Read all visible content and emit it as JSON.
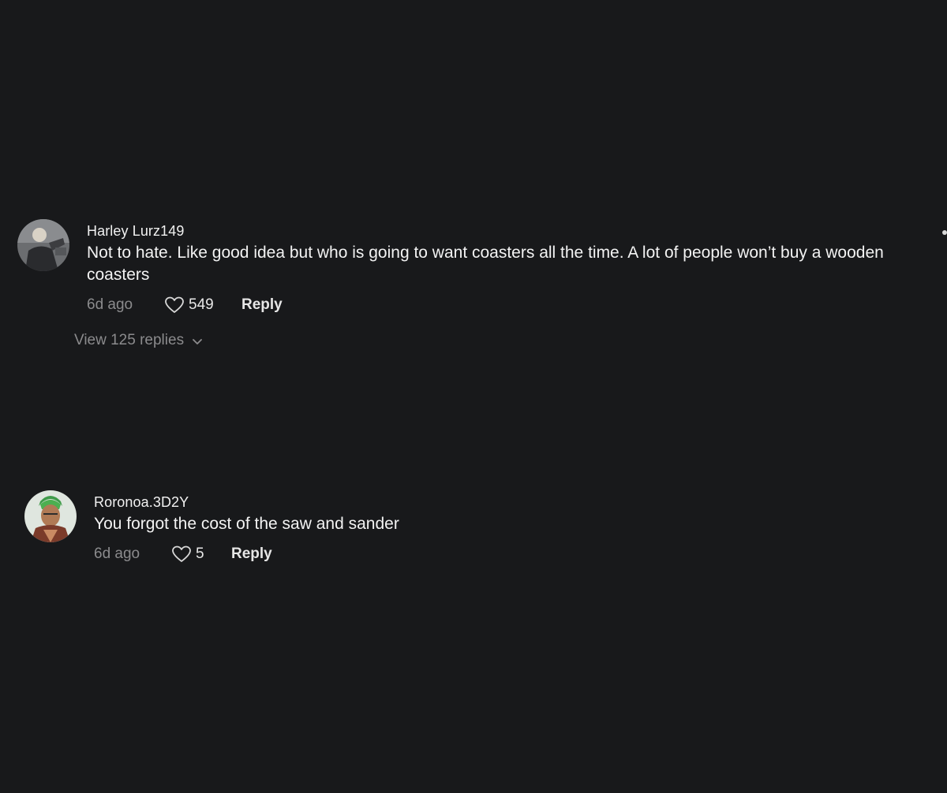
{
  "comments": [
    {
      "username": "Harley Lurz149",
      "text": "Not to hate. Like good idea but who is going to want coasters all the time. A lot of people won’t buy a wooden coasters",
      "time": "6d ago",
      "likes": "549",
      "reply_label": "Reply",
      "view_replies_label": "View 125 replies"
    },
    {
      "username": "Roronoa.3D2Y",
      "text": "You forgot the cost of the saw and sander",
      "time": "6d ago",
      "likes": "5",
      "reply_label": "Reply"
    }
  ],
  "icons": {
    "like": "heart-outline-icon",
    "expand": "chevron-down-icon"
  },
  "colors": {
    "background": "#18191b",
    "primary_text": "#f3f3f3",
    "secondary_text": "#8b8b8d"
  }
}
